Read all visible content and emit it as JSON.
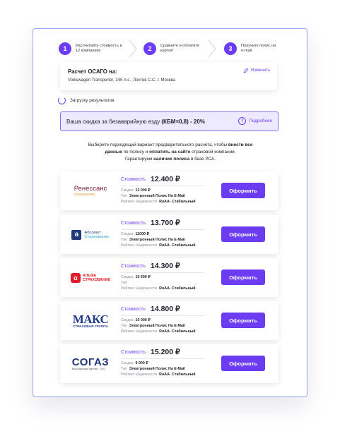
{
  "steps": [
    {
      "num": "1",
      "text": "Рассчитайте стоимость в 12 компаниях"
    },
    {
      "num": "2",
      "text": "Сравните и оплатите картой"
    },
    {
      "num": "3",
      "text": "Получите полис на e-mail"
    }
  ],
  "summary": {
    "title": "Расчет ОСАГО на:",
    "description": "Volkswagen Transporter, 245 л.с., Локтев С.С. г. Москва",
    "edit_label": "Изменить"
  },
  "loading_text": "Загрузку результатов",
  "discount": {
    "text_before": "Ваша скидка за безаварийную езду ",
    "text_bold": "(КБМ=0,8)",
    "text_after": " - 20%",
    "more_label": "Подробнее"
  },
  "intro": {
    "line1_a": "Выберите подходящий вариант предварительного расчета, чтобы ",
    "line1_b": "внести все",
    "line2_a": "данные",
    "line2_b": " по полису и ",
    "line2_c": "оплатить на сайте",
    "line2_d": " страховой компании.",
    "line3_a": "Гарантируем ",
    "line3_b": "наличие полиса",
    "line3_c": " в базе РСА."
  },
  "labels": {
    "price": "Стоимость",
    "discount": "Скидка",
    "type": "Тип",
    "rating": "Рейтинг Надежности",
    "order": "Оформить"
  },
  "offers": [
    {
      "company": "Ренессанс",
      "company_sub": "страхование",
      "price": "12.400 ₽",
      "discount": "12 000 ₽",
      "type": "Электронный Полис На E-Mail",
      "rating": "RuAA- Стабильный"
    },
    {
      "company": "Абсолют",
      "company_sub": "Страхование",
      "price": "13.700 ₽",
      "discount": "11000 ₽",
      "type": "Электронный Полис На E-Mail",
      "rating": "RuAA- Стабильный"
    },
    {
      "company": "АЛЬФА",
      "company_sub": "СТРАХОВАНИЕ",
      "price": "14.300 ₽",
      "discount": "10 500 ₽",
      "type": "",
      "rating": "RuAA- Стабильный"
    },
    {
      "company": "МАКС",
      "company_sub": "СТРАХОВАЯ ГРУППА",
      "price": "14.800 ₽",
      "discount": "10 000 ₽",
      "type": "Электронный Полис На E-Mail",
      "rating": "RuAA- Стабильный"
    },
    {
      "company": "СОГАЗ",
      "company_sub": "Ваш надежный партнер · ООО",
      "price": "15.200 ₽",
      "discount": "9 000 ₽",
      "type": "Электронный Полис На E-Mail",
      "rating": "RuAA- Стабильный"
    }
  ],
  "colors": {
    "accent": "#6b3cf2",
    "border": "#9aa6ef",
    "banner_bg": "#eeeafd"
  }
}
